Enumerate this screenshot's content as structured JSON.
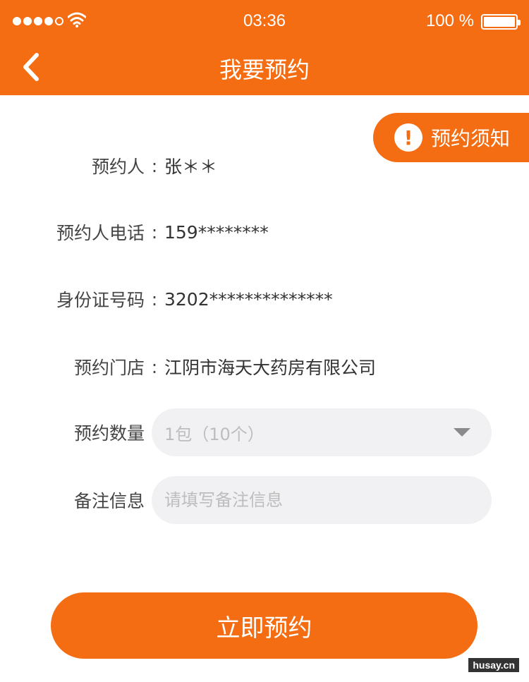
{
  "status_bar": {
    "time": "03:36",
    "battery_text": "100 %"
  },
  "nav": {
    "title": "我要预约"
  },
  "notice": {
    "label": "预约须知"
  },
  "form": {
    "colon": ":",
    "rows": [
      {
        "label": "预约人",
        "value": "张＊＊"
      },
      {
        "label": "预约人电话",
        "value": "159********"
      },
      {
        "label": "身份证号码",
        "value": "3202**************"
      },
      {
        "label": "预约门店",
        "value": "江阴市海天大药房有限公司"
      }
    ],
    "quantity": {
      "label": "预约数量",
      "value": "1包（10个）"
    },
    "remark": {
      "label": "备注信息",
      "placeholder": "请填写备注信息"
    }
  },
  "submit_label": "立即预约",
  "watermark": "husay.cn",
  "colors": {
    "accent": "#f46d12",
    "field_bg": "#f1f1f3"
  }
}
